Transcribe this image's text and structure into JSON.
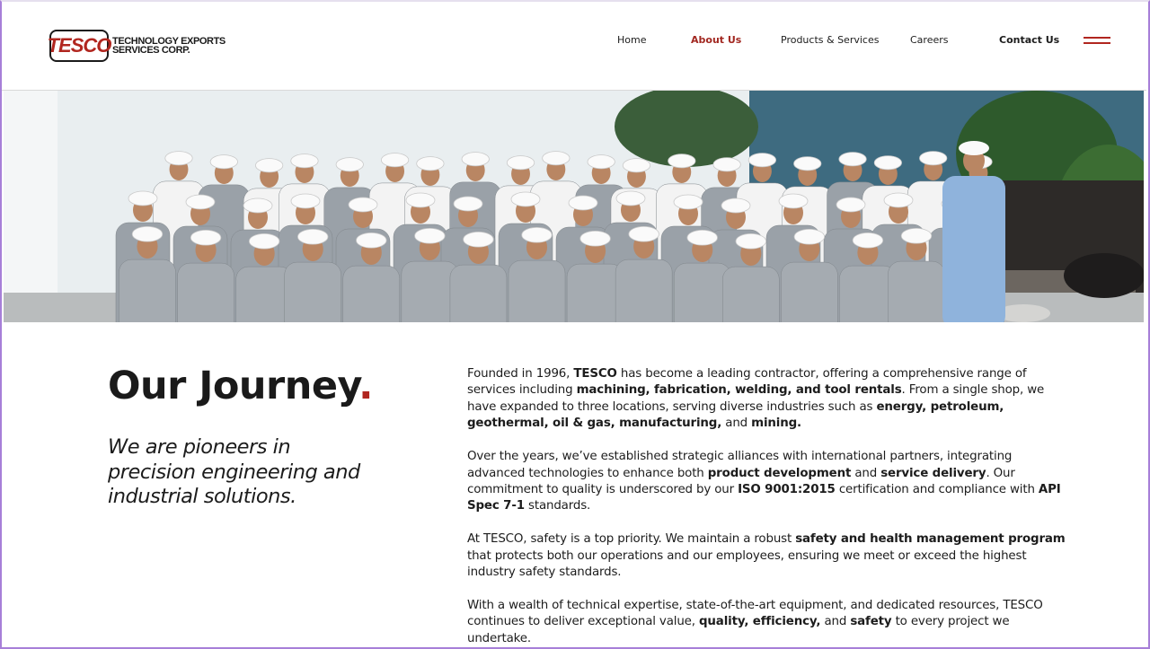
{
  "header": {
    "logo": {
      "mark": "TESCO",
      "line1": "TECHNOLOGY EXPORTS",
      "line2": "SERVICES CORP."
    },
    "nav": {
      "home": "Home",
      "about": "About Us",
      "products": "Products & Services",
      "careers": "Careers",
      "contact": "Contact Us"
    },
    "active_nav": "About Us",
    "accent_color": "#b1261f"
  },
  "hero": {
    "image": "team-group-photo",
    "icon": "menu-icon"
  },
  "main": {
    "title": "Our Journey",
    "title_dot": ".",
    "tagline": "We are pioneers in precision engineering and industrial solutions.",
    "paragraphs": [
      {
        "segments": [
          {
            "t": "Founded in 1996, "
          },
          {
            "t": "TESCO",
            "b": true
          },
          {
            "t": " has become a leading contractor, offering a comprehensive range of services including "
          },
          {
            "t": "machining, fabrication, welding, and tool rentals",
            "b": true
          },
          {
            "t": ". From a single shop, we have expanded to three locations, serving diverse industries such as "
          },
          {
            "t": "energy, petroleum, geothermal, oil & gas, manufacturing,",
            "b": true
          },
          {
            "t": " and "
          },
          {
            "t": "mining.",
            "b": true
          }
        ]
      },
      {
        "segments": [
          {
            "t": "Over the years, we’ve established strategic alliances with international partners, integrating advanced technologies to enhance both "
          },
          {
            "t": "product development",
            "b": true
          },
          {
            "t": " and "
          },
          {
            "t": "service delivery",
            "b": true
          },
          {
            "t": ". Our commitment to quality is underscored by our "
          },
          {
            "t": "ISO 9001:2015",
            "b": true
          },
          {
            "t": " certification and compliance with "
          },
          {
            "t": "API Spec 7-1",
            "b": true
          },
          {
            "t": " standards."
          }
        ]
      },
      {
        "segments": [
          {
            "t": "At TESCO, safety is a top priority. We maintain a robust "
          },
          {
            "t": "safety and health management program",
            "b": true
          },
          {
            "t": " that protects both our operations and our employees, ensuring we meet or exceed the highest industry safety standards."
          }
        ]
      },
      {
        "segments": [
          {
            "t": "With a wealth of technical expertise, state-of-the-art equipment, and dedicated resources, TESCO continues to deliver exceptional value, "
          },
          {
            "t": "quality, efficiency,",
            "b": true
          },
          {
            "t": " and "
          },
          {
            "t": "safety",
            "b": true
          },
          {
            "t": " to every project we undertake."
          }
        ]
      }
    ]
  }
}
